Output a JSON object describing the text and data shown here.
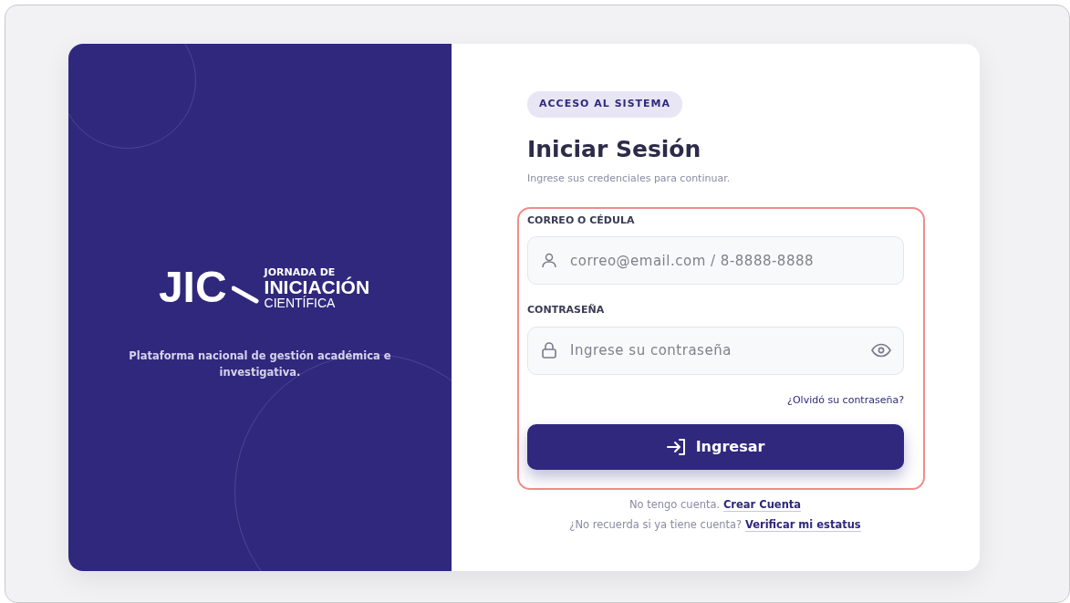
{
  "brand": {
    "logo_mark": "JIC",
    "line_1": "JORNADA DE",
    "line_2": "INICIACIÓN",
    "line_3": "CIENTÍFICA",
    "tagline": "Plataforma nacional de gestión académica e investigativa."
  },
  "badge": "ACCESO AL SISTEMA",
  "title": "Iniciar Sesión",
  "subtitle": "Ingrese sus credenciales para continuar.",
  "fields": [
    {
      "kind": "user",
      "label": "CORREO O CÉDULA",
      "placeholder": "correo@email.com / 8-8888-8888"
    },
    {
      "kind": "password",
      "label": "CONTRASEÑA",
      "placeholder": "Ingrese su contraseña"
    }
  ],
  "forgot_link": "¿Olvidó su contraseña?",
  "submit_button": "Ingresar",
  "footer_lines": [
    {
      "text": "No tengo cuenta.",
      "link": "Crear Cuenta"
    },
    {
      "text": "¿No recuerda si ya tiene cuenta?",
      "link": "Verificar mi estatus"
    }
  ]
}
